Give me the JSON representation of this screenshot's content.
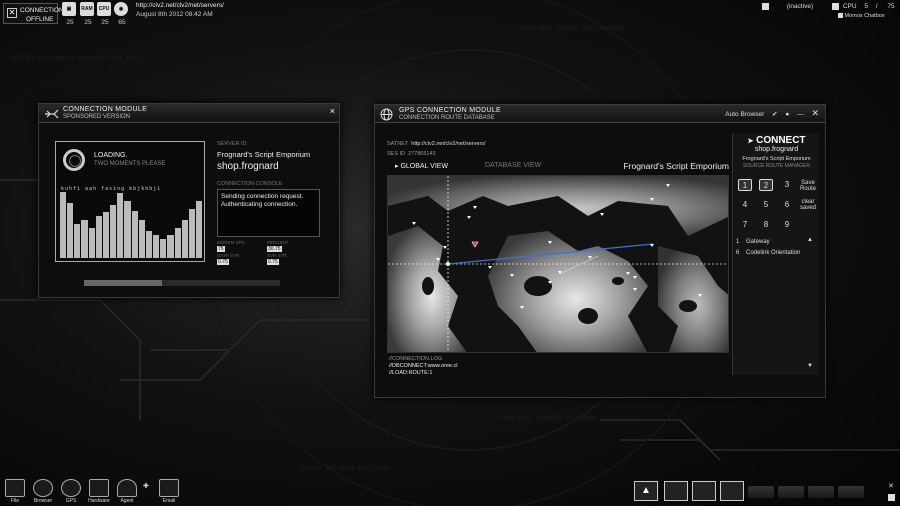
{
  "topbar": {
    "status_line1": "CONNECTION",
    "status_line2": "OFFLINE",
    "meters": [
      {
        "icon": "gateway-icon",
        "value": "25"
      },
      {
        "icon": "ram-icon",
        "value": "25"
      },
      {
        "icon": "cpu-icon",
        "value": "25"
      },
      {
        "icon": "modem-icon",
        "value": "65"
      }
    ],
    "url": "http://clv2.net/clv2/net/servers/",
    "date": "August 8th 2012 08:42 AM",
    "inactive": "(inactive)",
    "cpu_label": "CPU",
    "cpu_value": "5",
    "cpu_sep": "/",
    "cpu_max": "75",
    "chatbox": "Momos Chatbox"
  },
  "conn_window": {
    "title": "CONNECTION MODULE",
    "subtitle": "SPONSORED VERSION",
    "loading": "LOADING.",
    "loading_sub": "TWO MOMENTS PLEASE",
    "scramble": "kuhfi aah fasing kbjkhbji",
    "bar_levels": [
      0.87,
      0.72,
      0.45,
      0.5,
      0.4,
      0.55,
      0.6,
      0.7,
      0.85,
      0.75,
      0.62,
      0.5,
      0.35,
      0.3,
      0.25,
      0.3,
      0.4,
      0.5,
      0.65,
      0.75
    ],
    "server_id_label": "SERVER ID",
    "server_name": "Frognard's Script Emporium",
    "server_host": "shop.frognard",
    "console_label": "CONNECTION CONSOLE",
    "console_lines": [
      "Sending connection request.",
      "Authenticating connection."
    ],
    "stats": [
      {
        "label": "MODEM SPD",
        "value": "75"
      },
      {
        "label": "PERCENT",
        "value": "30.75"
      },
      {
        "label": "GATE STR",
        "value": "0.75"
      },
      {
        "label": "SVR STR",
        "value": "0.75"
      }
    ],
    "progress": 0.4
  },
  "gps_window": {
    "title": "GPS CONNECTION MODULE",
    "subtitle": "CONNECTION ROUTE DATABASE",
    "auto_browser": "Auto Browser",
    "satnet_label": "SATNET",
    "satnet_value": "http://clv2.net/clv2/net/servers/",
    "sesid_label": "SES ID",
    "sesid_value": "277865143",
    "tab_global": "GLOBAL VIEW",
    "tab_database": "DATABASE VIEW",
    "map_title": "Frognard's Script Emporium",
    "log_label": "//CONNECTION.LOG",
    "log_lines": [
      "//DBCONNECT:www.oree.cl",
      "//LOAD:ROUTE:1"
    ],
    "panel": {
      "brand": "CONNECT",
      "host": "shop.frognard",
      "emporium": "Frognard's Script Emporium",
      "manager": "SOURCE ROUTE MANAGER",
      "keys": [
        "1",
        "2",
        "3",
        "4",
        "5",
        "6",
        "7",
        "8",
        "9"
      ],
      "active_keys": [
        "1",
        "2"
      ],
      "save_label": "Save Route",
      "clear_label": "clear saved",
      "routes": [
        {
          "num": "1",
          "name": "Gateway"
        },
        {
          "num": "6",
          "name": "Codelink Orientation"
        }
      ]
    }
  },
  "dock": {
    "left": [
      {
        "label": "File",
        "icon": "file-icon"
      },
      {
        "label": "Browser",
        "icon": "browser-icon"
      },
      {
        "label": "GPS",
        "icon": "globe-icon"
      },
      {
        "label": "Hardware",
        "icon": "hardware-icon"
      },
      {
        "label": "Agent",
        "icon": "agent-icon"
      },
      {
        "label": "Email",
        "icon": "email-icon"
      }
    ]
  }
}
